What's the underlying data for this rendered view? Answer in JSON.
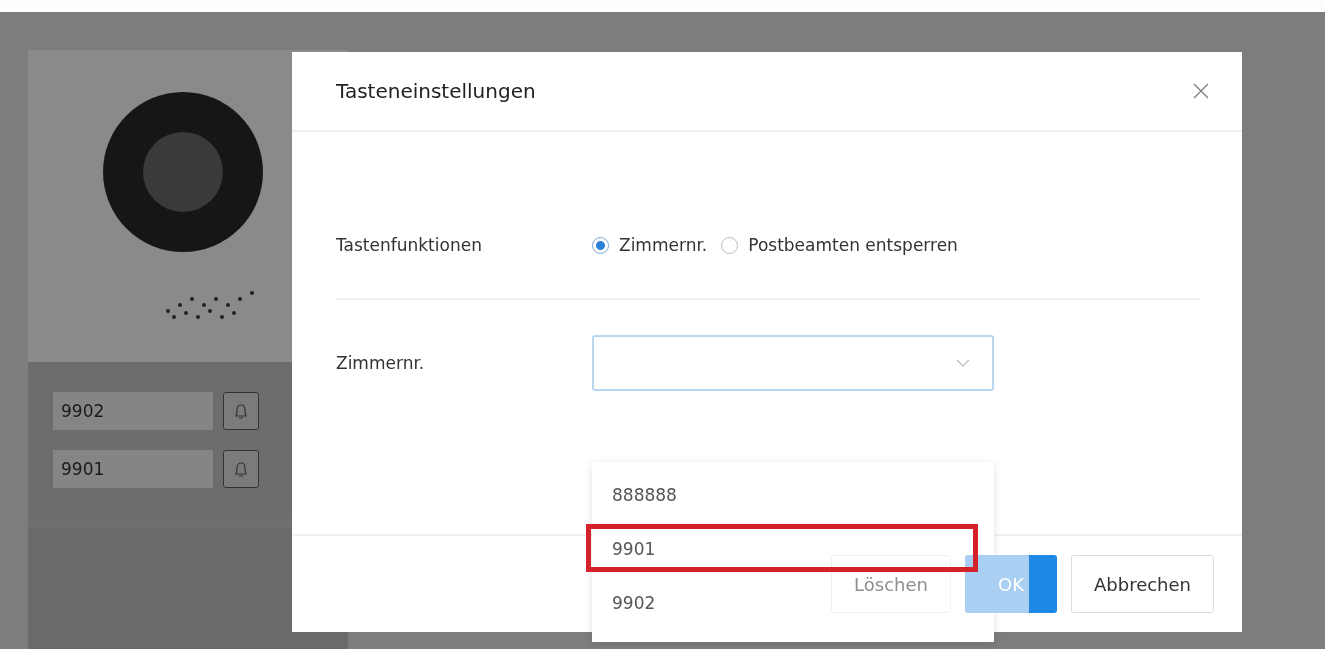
{
  "device": {
    "name_tags": [
      {
        "label": "9902"
      },
      {
        "label": "9901"
      }
    ]
  },
  "dialog": {
    "title": "Tasteneinstellungen",
    "fields": [
      {
        "kind": "radio",
        "label": "Tastenfunktionen",
        "options": [
          {
            "label": "Zimmernr.",
            "selected": true
          },
          {
            "label": "Postbeamten entsperren",
            "selected": false
          }
        ]
      },
      {
        "kind": "select",
        "label": "Zimmernr.",
        "expanded": true,
        "options": [
          {
            "label": "888888",
            "highlighted": false
          },
          {
            "label": "9901",
            "highlighted": true
          },
          {
            "label": "9902",
            "highlighted": false
          }
        ]
      }
    ],
    "buttons": [
      {
        "label": "Löschen",
        "kind": "plain",
        "disabled": true
      },
      {
        "label": "OK",
        "kind": "primary",
        "disabled": true
      },
      {
        "label": "Abbrechen",
        "kind": "plain",
        "disabled": false
      }
    ]
  }
}
